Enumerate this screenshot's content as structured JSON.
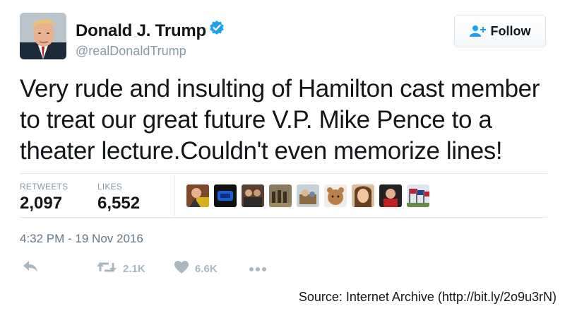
{
  "user": {
    "name": "Donald J. Trump",
    "handle": "@realDonaldTrump",
    "verified": true,
    "avatar_icon": "profile-photo"
  },
  "follow_button": {
    "label": "Follow",
    "icon": "add-person-icon"
  },
  "tweet": {
    "line1": "Very rude and insulting of Hamilton cast member",
    "line2": "to treat our great future V.P. Mike Pence to a",
    "line3": "theater lecture.Couldn't even memorize lines!"
  },
  "stats": {
    "retweets_label": "RETWEETS",
    "retweets_value": "2,097",
    "likes_label": "LIKES",
    "likes_value": "6,552"
  },
  "likers": [
    "liker-1",
    "liker-2",
    "liker-3",
    "liker-4",
    "liker-5",
    "liker-6",
    "liker-7",
    "liker-8",
    "liker-9"
  ],
  "timestamp": "4:32 PM - 19 Nov 2016",
  "actions": {
    "reply_icon": "reply-icon",
    "retweet_count": "2.1K",
    "like_count": "6.6K",
    "more_icon": "more-icon"
  },
  "source": "Source: Internet Archive (http://bit.ly/2o9u3rN)",
  "colors": {
    "verified_blue": "#1da1f2",
    "follow_icon_blue": "#1da1f2",
    "muted_gray": "#8899a6",
    "action_gray": "#aab8c2"
  }
}
